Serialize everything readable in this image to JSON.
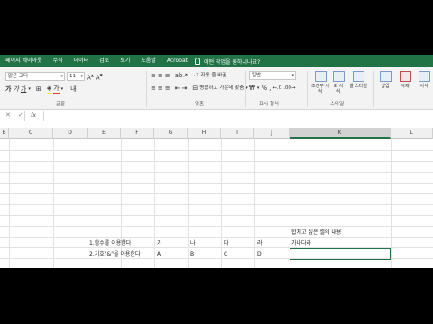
{
  "tabs": [
    "페이지 레이아웃",
    "수식",
    "데이터",
    "검토",
    "보기",
    "도움말",
    "Acrobat"
  ],
  "tell_me": "어떤 작업을 원하시나요?",
  "font": {
    "name": "맑은 고딕",
    "size": "11"
  },
  "font_group": {
    "label": "글꼴"
  },
  "align_group": {
    "label": "맞춤",
    "wrap": "자동 줄 바꿈",
    "merge": "병합하고 가운데 맞춤"
  },
  "number_group": {
    "label": "표시 형식",
    "format": "일반"
  },
  "style_group": {
    "label": "스타일",
    "conditional": "조건부 서식",
    "table": "표 서식",
    "cell": "셀 스타일"
  },
  "cells_group": {
    "insert": "삽입",
    "delete": "삭제",
    "format": "서식"
  },
  "formula_bar": {
    "fx": "fx"
  },
  "columns": [
    "B",
    "C",
    "D",
    "E",
    "F",
    "G",
    "H",
    "I",
    "J",
    "K",
    "L"
  ],
  "sheet": {
    "k_header": "합치고 싶은 셀의 내용",
    "k_value": "가나다라",
    "row1_label": "1.함수를 이용한다",
    "row2_label": "2.기호\"&\"을 이용한다",
    "row1": [
      "가",
      "나",
      "다",
      "라"
    ],
    "row2": [
      "A",
      "B",
      "C",
      "D"
    ]
  }
}
